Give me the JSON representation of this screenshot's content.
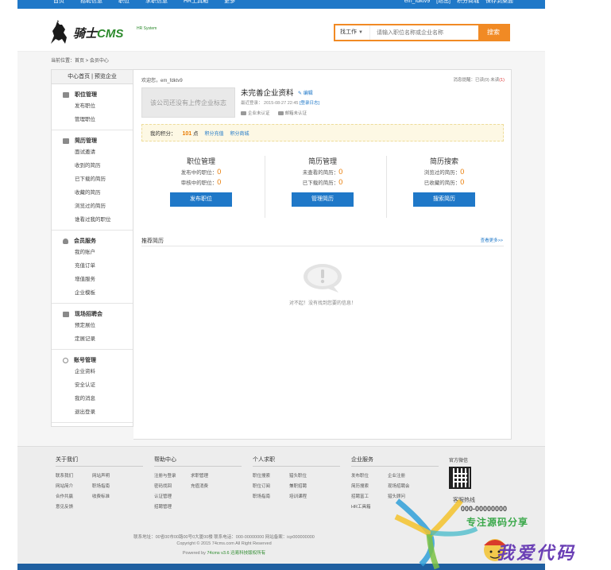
{
  "topbar": {
    "nav": [
      "首页",
      "招聘信息",
      "职位",
      "求职信息",
      "HR工具箱",
      "更多"
    ],
    "user": [
      "em_fdktv9",
      "[退出]",
      "积分商城",
      "保存到桌面"
    ]
  },
  "header": {
    "logo_text": "骑士",
    "logo_cms": "CMS",
    "logo_sub": "HR System",
    "search_type": "找工作",
    "search_placeholder": "请输入职位名称或企业名称",
    "search_button": "搜索"
  },
  "breadcrumb": "当前位置：首页 > 会员中心",
  "sidebar": {
    "top": "中心首页 | 预览企业",
    "groups": [
      {
        "title": "职位管理",
        "icon": "folder-icon",
        "items": [
          "发布职位",
          "管理职位"
        ]
      },
      {
        "title": "简历管理",
        "icon": "resume-icon",
        "items": [
          "面试邀请",
          "收到的简历",
          "已下载的简历",
          "收藏的简历",
          "浏览过的简历",
          "谁看过我的职位"
        ]
      },
      {
        "title": "会员服务",
        "icon": "user-icon",
        "items": [
          "我的账户",
          "充值订单",
          "增值服务",
          "企业模板"
        ]
      },
      {
        "title": "现场招聘会",
        "icon": "booth-icon",
        "items": [
          "预定展位",
          "定展记录"
        ]
      },
      {
        "title": "账号管理",
        "icon": "account-icon",
        "items": [
          "企业资料",
          "安全认证",
          "我的消息",
          "退出登录"
        ]
      }
    ]
  },
  "content": {
    "welcome": "欢迎您，em_fdktv9",
    "messages_label": "消息提醒：",
    "messages_read": "已读(0)",
    "messages_unread_label": "未读",
    "messages_unread": "(1)",
    "logo_placeholder": "该公司还没有上传企业标志",
    "company_name": "未完善企业资料",
    "edit": "编辑",
    "last_login_label": "最近登录： 2015-08-27 22:45",
    "last_login_link": "[登录日志]",
    "verify_company": "企业未认证",
    "verify_email": "邮箱未认证",
    "points_label": "我的积分：",
    "points_value": "101",
    "points_unit": "点",
    "points_recharge": "积分充值",
    "points_mall": "积分商城",
    "modules": [
      {
        "title": "职位管理",
        "lines": [
          {
            "label": "发布中的职位：",
            "value": "0"
          },
          {
            "label": "审核中的职位：",
            "value": "0"
          }
        ],
        "button": "发布职位"
      },
      {
        "title": "简历管理",
        "lines": [
          {
            "label": "未查看的简历：",
            "value": "0"
          },
          {
            "label": "已下载的简历：",
            "value": "0"
          }
        ],
        "button": "管理简历"
      },
      {
        "title": "简历搜索",
        "lines": [
          {
            "label": "浏览过的简历：",
            "value": "0"
          },
          {
            "label": "已收藏的简历：",
            "value": "0"
          }
        ],
        "button": "搜索简历"
      }
    ],
    "recommend_title": "推荐简历",
    "more": "查看更多>>",
    "empty_text": "对不起！没有找到您要的信息！"
  },
  "footer": {
    "columns": [
      {
        "title": "关于我们",
        "links": [
          "联系我们",
          "网站声明",
          "网站简介",
          "职场指南",
          "合作共赢",
          "收费标准",
          "意见反馈"
        ]
      },
      {
        "title": "帮助中心",
        "links": [
          "注册与登录",
          "求职管理",
          "密码找回",
          "充值消费",
          "认证管理",
          "",
          "招聘管理"
        ]
      },
      {
        "title": "个人求职",
        "links": [
          "职位搜索",
          "猎头职位",
          "职位订阅",
          "兼职招聘",
          "职场指南",
          "培训课程"
        ]
      },
      {
        "title": "企业服务",
        "links": [
          "发布职位",
          "企业注册",
          "简历搜索",
          "现场招聘会",
          "招聘富工",
          "猎头顾问",
          "HR工具箱",
          ""
        ]
      }
    ],
    "wechat": "官方微信",
    "hotline_label": "客服热线",
    "hotline": "000-00000000",
    "bottom_line1": "联系地址：00省00市00路00号0大厦00楼 联系电话：000-00000000 网站备案：icp000000000",
    "bottom_line2": "Copyright © 2015 74cms.com All Right Reserved",
    "bottom_line3_a": "Powered by",
    "bottom_line3_b": "74cms v3.6 迅易科技版权所有"
  },
  "watermark": {
    "line1": "专注源码分享",
    "line2": "我爱代码"
  }
}
